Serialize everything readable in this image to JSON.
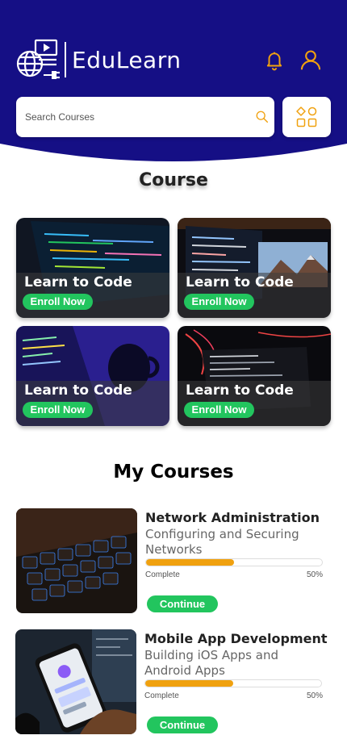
{
  "app": {
    "title": "EduLearn"
  },
  "colors": {
    "header": "#150f85",
    "accent": "#f0a10f",
    "button": "#22c55e"
  },
  "icons": {
    "logo": "elearning-logo",
    "notifications": "bell-icon",
    "profile": "user-icon",
    "search": "search-icon",
    "grid": "grid-icon"
  },
  "search": {
    "placeholder": "Search Courses"
  },
  "course_section": {
    "title": "Course",
    "cards": [
      {
        "title": "Learn to Code",
        "button": "Enroll Now"
      },
      {
        "title": "Learn to Code",
        "button": "Enroll Now"
      },
      {
        "title": "Learn to Code",
        "button": "Enroll Now"
      },
      {
        "title": "Learn to Code",
        "button": "Enroll Now"
      }
    ]
  },
  "my_courses": {
    "title": "My Courses",
    "items": [
      {
        "title": "Network Administration",
        "subtitle": "Configuring and Securing Networks",
        "progress_label": "Complete",
        "progress_text": "50%",
        "progress": 0.5,
        "button": "Continue"
      },
      {
        "title": "Mobile App Development",
        "subtitle": "Building iOS Apps and Android Apps",
        "progress_label": "Complete",
        "progress_text": "50%",
        "progress": 0.5,
        "button": "Continue"
      }
    ]
  }
}
